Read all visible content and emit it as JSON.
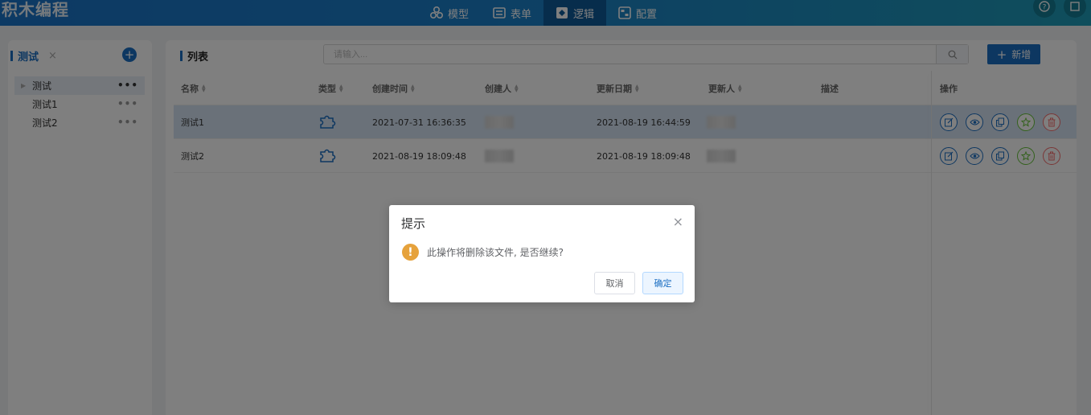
{
  "app": {
    "logo": "积木编程",
    "nav": [
      {
        "label": "模型",
        "icon": "model-icon"
      },
      {
        "label": "表单",
        "icon": "form-icon"
      },
      {
        "label": "逻辑",
        "icon": "logic-icon",
        "active": true
      },
      {
        "label": "配置",
        "icon": "config-icon"
      }
    ]
  },
  "left": {
    "tab_label": "测试",
    "tab_close": "×",
    "add_symbol": "+",
    "tree": [
      {
        "label": "测试",
        "more": "•••"
      },
      {
        "label": "测试1",
        "more": "•••"
      },
      {
        "label": "测试2",
        "more": "•••"
      }
    ]
  },
  "main": {
    "title": "列表",
    "search_placeholder": "请输入...",
    "add_label": "新增",
    "add_symbol": "+",
    "columns": [
      "名称",
      "类型",
      "创建时间",
      "创建人",
      "更新日期",
      "更新人",
      "描述",
      "操作"
    ],
    "rows": [
      {
        "name": "测试1",
        "created": "2021-07-31 16:36:35",
        "updated": "2021-08-19 16:44:59"
      },
      {
        "name": "测试2",
        "created": "2021-08-19 18:09:48",
        "updated": "2021-08-19 18:09:48"
      }
    ],
    "op_icons": [
      "edit-icon",
      "view-icon",
      "copy-icon",
      "publish-icon",
      "delete-icon"
    ],
    "colors": {
      "primary": "#1b6ec2",
      "success": "#67c23a",
      "danger": "#f56c6c"
    }
  },
  "dialog": {
    "title": "提示",
    "close": "×",
    "icon": "!",
    "message": "此操作将删除该文件, 是否继续?",
    "cancel_label": "取消",
    "ok_label": "确定",
    "warning_color": "#e6a23c"
  }
}
